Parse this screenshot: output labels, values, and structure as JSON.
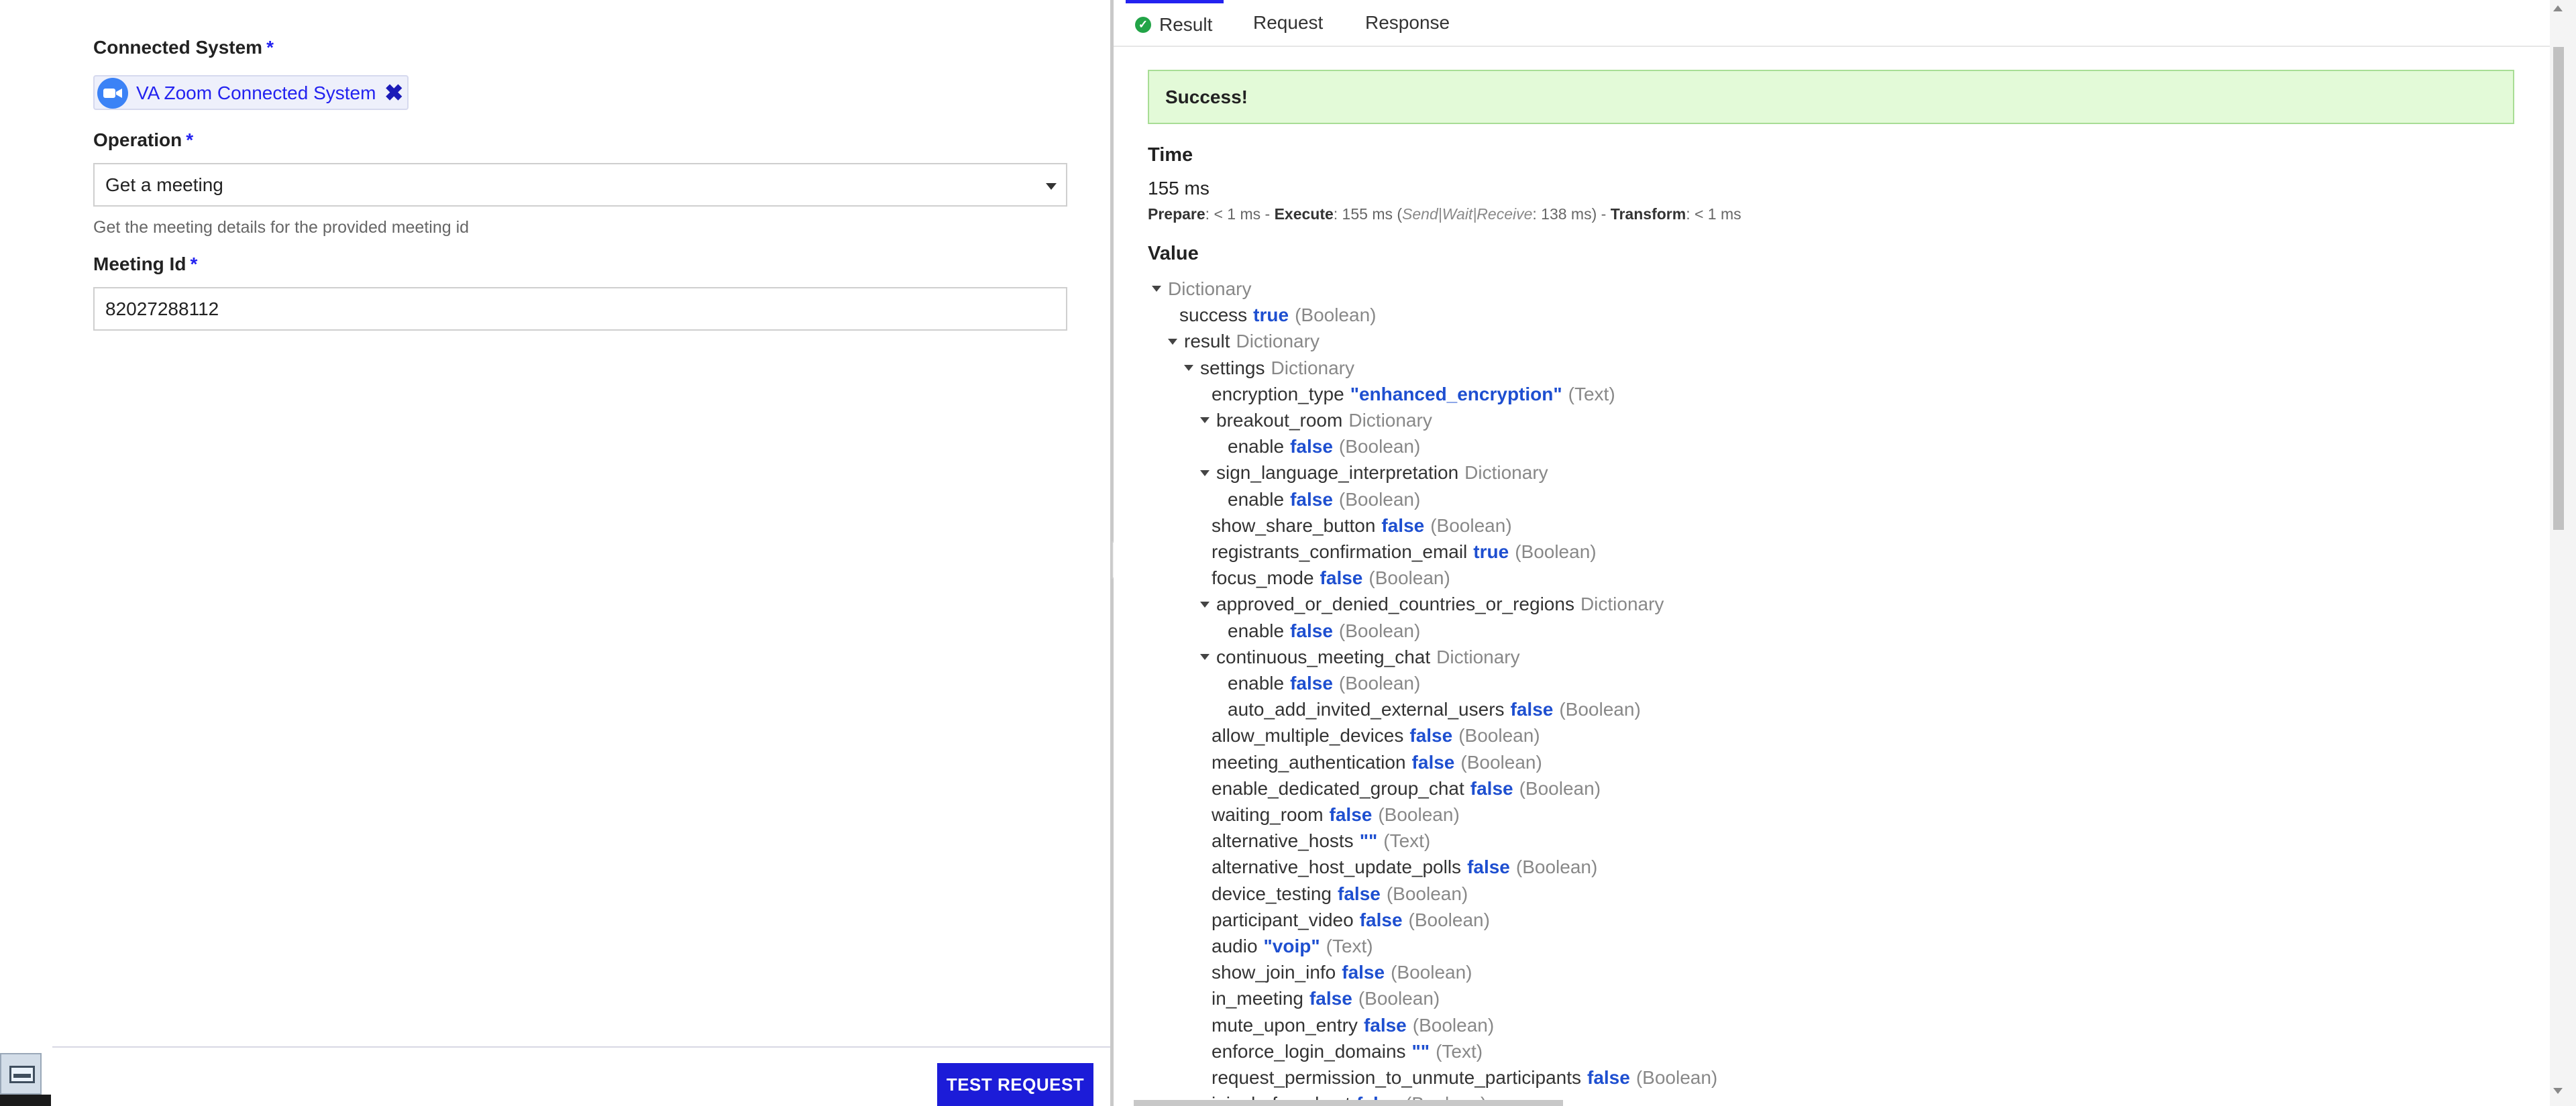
{
  "form": {
    "connected_system": {
      "label": "Connected System",
      "required_mark": "*",
      "chip_label": "VA Zoom Connected System",
      "chip_icon": "video-camera-icon",
      "remove_icon": "close-icon",
      "remove_glyph": "✖"
    },
    "operation": {
      "label": "Operation",
      "required_mark": "*",
      "value": "Get a meeting",
      "help": "Get the meeting details for the provided meeting id"
    },
    "meeting_id": {
      "label": "Meeting Id",
      "required_mark": "*",
      "value": "82027288112"
    },
    "test_button": "TEST REQUEST"
  },
  "tabs": [
    {
      "label": "Result",
      "active": true,
      "icon": "check-circle-icon"
    },
    {
      "label": "Request",
      "active": false
    },
    {
      "label": "Response",
      "active": false
    }
  ],
  "result": {
    "status": "Success!",
    "time_title": "Time",
    "time_value": "155 ms",
    "timing": {
      "prepare_label": "Prepare",
      "prepare_value": ": < 1 ms - ",
      "execute_label": "Execute",
      "execute_value": ": 155 ms (",
      "breakdown_label": "Send|Wait|Receive",
      "breakdown_value": ": 138 ms) - ",
      "transform_label": "Transform",
      "transform_value": ": < 1 ms"
    },
    "value_title": "Value",
    "tree": [
      {
        "depth": 0,
        "caret": true,
        "key": "",
        "val": "",
        "type": "Dictionary"
      },
      {
        "depth": 1,
        "caret": false,
        "key": "success",
        "val": "true",
        "type": "(Boolean)"
      },
      {
        "depth": 1,
        "caret": true,
        "key": "result",
        "val": "",
        "type": "Dictionary"
      },
      {
        "depth": 2,
        "caret": true,
        "key": "settings",
        "val": "",
        "type": "Dictionary"
      },
      {
        "depth": 3,
        "caret": false,
        "key": "encryption_type",
        "val": "\"enhanced_encryption\"",
        "type": "(Text)"
      },
      {
        "depth": 3,
        "caret": true,
        "key": "breakout_room",
        "val": "",
        "type": "Dictionary"
      },
      {
        "depth": 4,
        "caret": false,
        "key": "enable",
        "val": "false",
        "type": "(Boolean)"
      },
      {
        "depth": 3,
        "caret": true,
        "key": "sign_language_interpretation",
        "val": "",
        "type": "Dictionary"
      },
      {
        "depth": 4,
        "caret": false,
        "key": "enable",
        "val": "false",
        "type": "(Boolean)"
      },
      {
        "depth": 3,
        "caret": false,
        "key": "show_share_button",
        "val": "false",
        "type": "(Boolean)"
      },
      {
        "depth": 3,
        "caret": false,
        "key": "registrants_confirmation_email",
        "val": "true",
        "type": "(Boolean)"
      },
      {
        "depth": 3,
        "caret": false,
        "key": "focus_mode",
        "val": "false",
        "type": "(Boolean)"
      },
      {
        "depth": 3,
        "caret": true,
        "key": "approved_or_denied_countries_or_regions",
        "val": "",
        "type": "Dictionary"
      },
      {
        "depth": 4,
        "caret": false,
        "key": "enable",
        "val": "false",
        "type": "(Boolean)"
      },
      {
        "depth": 3,
        "caret": true,
        "key": "continuous_meeting_chat",
        "val": "",
        "type": "Dictionary"
      },
      {
        "depth": 4,
        "caret": false,
        "key": "enable",
        "val": "false",
        "type": "(Boolean)"
      },
      {
        "depth": 4,
        "caret": false,
        "key": "auto_add_invited_external_users",
        "val": "false",
        "type": "(Boolean)"
      },
      {
        "depth": 3,
        "caret": false,
        "key": "allow_multiple_devices",
        "val": "false",
        "type": "(Boolean)"
      },
      {
        "depth": 3,
        "caret": false,
        "key": "meeting_authentication",
        "val": "false",
        "type": "(Boolean)"
      },
      {
        "depth": 3,
        "caret": false,
        "key": "enable_dedicated_group_chat",
        "val": "false",
        "type": "(Boolean)"
      },
      {
        "depth": 3,
        "caret": false,
        "key": "waiting_room",
        "val": "false",
        "type": "(Boolean)"
      },
      {
        "depth": 3,
        "caret": false,
        "key": "alternative_hosts",
        "val": "\"\"",
        "type": "(Text)"
      },
      {
        "depth": 3,
        "caret": false,
        "key": "alternative_host_update_polls",
        "val": "false",
        "type": "(Boolean)"
      },
      {
        "depth": 3,
        "caret": false,
        "key": "device_testing",
        "val": "false",
        "type": "(Boolean)"
      },
      {
        "depth": 3,
        "caret": false,
        "key": "participant_video",
        "val": "false",
        "type": "(Boolean)"
      },
      {
        "depth": 3,
        "caret": false,
        "key": "audio",
        "val": "\"voip\"",
        "type": "(Text)"
      },
      {
        "depth": 3,
        "caret": false,
        "key": "show_join_info",
        "val": "false",
        "type": "(Boolean)"
      },
      {
        "depth": 3,
        "caret": false,
        "key": "in_meeting",
        "val": "false",
        "type": "(Boolean)"
      },
      {
        "depth": 3,
        "caret": false,
        "key": "mute_upon_entry",
        "val": "false",
        "type": "(Boolean)"
      },
      {
        "depth": 3,
        "caret": false,
        "key": "enforce_login_domains",
        "val": "\"\"",
        "type": "(Text)"
      },
      {
        "depth": 3,
        "caret": false,
        "key": "request_permission_to_unmute_participants",
        "val": "false",
        "type": "(Boolean)"
      },
      {
        "depth": 3,
        "caret": false,
        "key": "join_before_host",
        "val": "false",
        "type": "(Boolean)"
      }
    ]
  },
  "icons": {
    "collapse_left": "arrow-left-icon",
    "collapse_right": "arrow-left-icon",
    "taskbar": "screenshot-app-icon"
  },
  "colors": {
    "accent": "#2322f0",
    "success_bg": "#e3fad8",
    "value_blue": "#1e4fd0",
    "button_bg": "#1c1cd8"
  }
}
